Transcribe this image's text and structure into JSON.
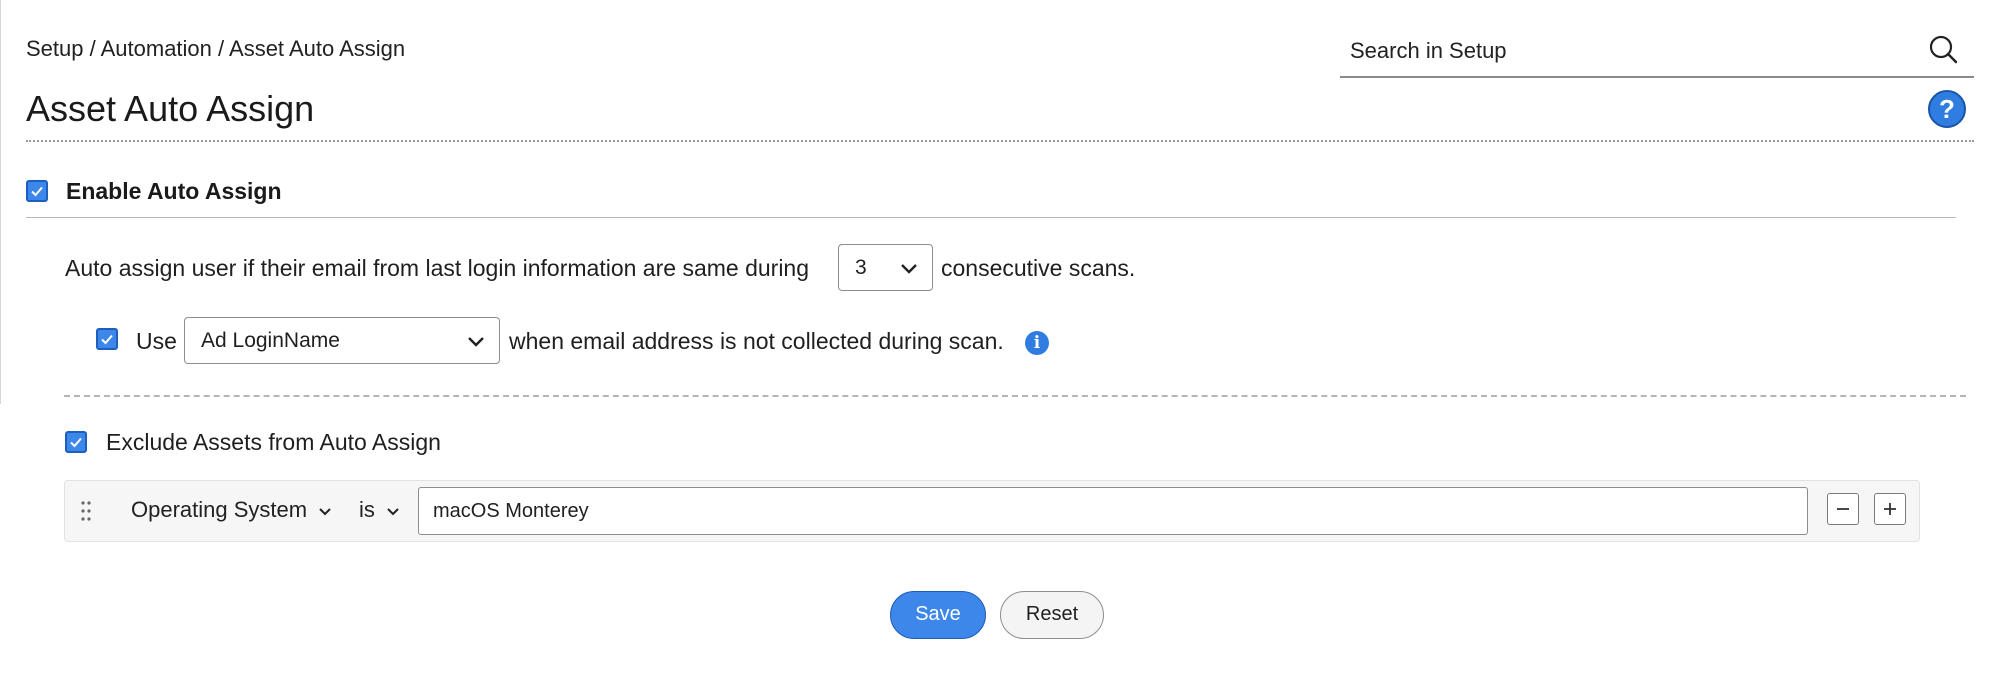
{
  "header": {
    "breadcrumb": "Setup / Automation / Asset Auto Assign",
    "search_placeholder": "Search in Setup",
    "page_title": "Asset Auto Assign",
    "help_symbol": "?"
  },
  "enable": {
    "checked": true,
    "label": "Enable Auto Assign"
  },
  "rule": {
    "text_before": "Auto assign user if their email from last login information are same during",
    "scans_value": "3",
    "text_after": "consecutive scans.",
    "use_checked": true,
    "use_label": "Use",
    "fallback_field": "Ad LoginName",
    "fallback_text": "when email address is not collected during scan.",
    "info_symbol": "i"
  },
  "exclude": {
    "checked": true,
    "label": "Exclude Assets from Auto Assign",
    "condition": {
      "field": "Operating System",
      "operator": "is",
      "value": "macOS Monterey"
    }
  },
  "actions": {
    "save_label": "Save",
    "reset_label": "Reset"
  },
  "colors": {
    "accent": "#3d86ea",
    "accent_border": "#1f5cb5",
    "help_icon": "#2f7de1"
  }
}
